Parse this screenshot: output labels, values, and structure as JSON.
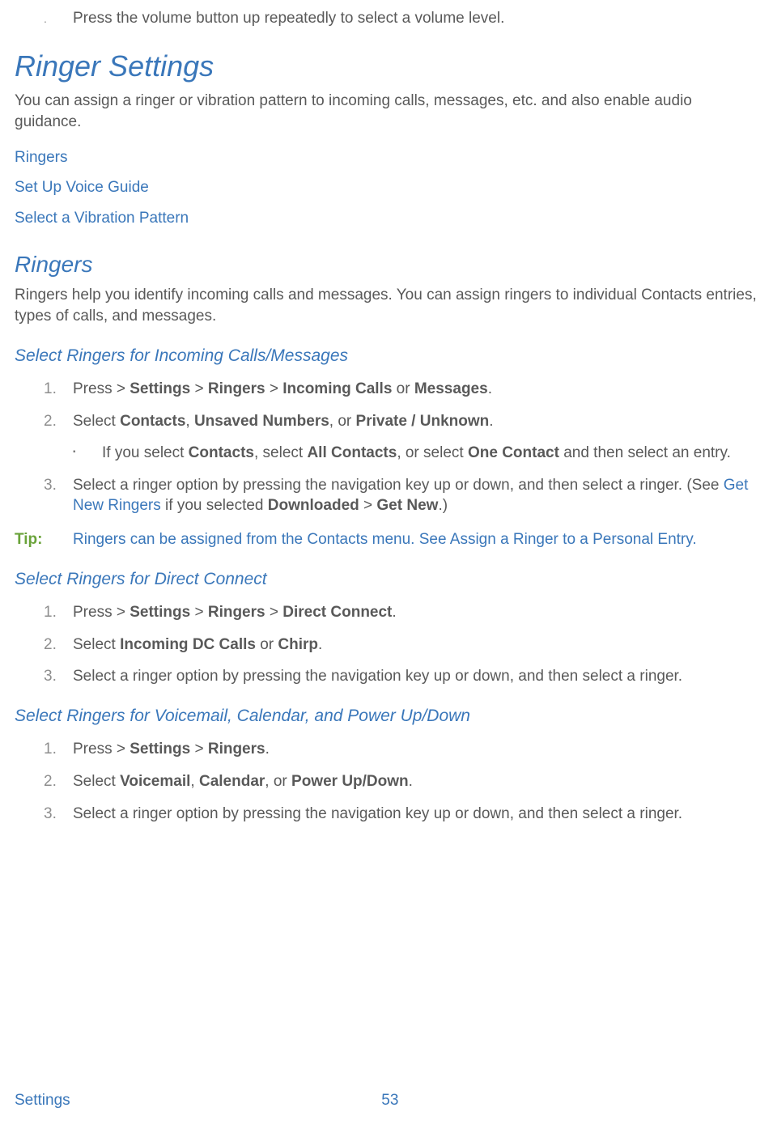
{
  "top_bullet": "Press the volume button up repeatedly to select a volume level.",
  "h1": "Ringer Settings",
  "h1_para": "You can assign a ringer or vibration pattern to incoming calls, messages, etc. and also enable audio guidance.",
  "links": {
    "ringers": "Ringers",
    "voice_guide": "Set Up Voice Guide",
    "vibration": "Select a Vibration Pattern"
  },
  "h2": "Ringers",
  "h2_para": "Ringers help you identify incoming calls and messages. You can assign ringers to individual Contacts entries, types of calls, and messages.",
  "sec1": {
    "title": "Select Ringers for Incoming Calls/Messages",
    "steps": {
      "s1": {
        "num": "1.",
        "pre": "Press  > ",
        "b1": "Settings",
        "g1": " > ",
        "b2": "Ringers",
        "g2": " > ",
        "b3": "Incoming Calls",
        "g3": " or ",
        "b4": "Messages",
        "g4": "."
      },
      "s2": {
        "num": "2.",
        "pre": "Select ",
        "b1": "Contacts",
        "g1": ", ",
        "b2": "Unsaved Numbers",
        "g2": ", or ",
        "b3": "Private / Unknown",
        "g3": "."
      },
      "sub": {
        "pre": "If you select ",
        "b1": "Contacts",
        "g1": ", select ",
        "b2": "All Contacts",
        "g2": ", or select ",
        "b3": "One Contact",
        "g3": " and then select an entry."
      },
      "s3": {
        "num": "3.",
        "pre": "Select a ringer option by pressing the navigation key up or down, and then select a ringer. (See ",
        "link": "Get New Ringers",
        "mid": " if you selected ",
        "b1": "Downloaded",
        "g1": " > ",
        "b2": "Get New",
        "g2": ".)"
      }
    }
  },
  "tip": {
    "label": "Tip:",
    "pre": "Ringers can be assigned from the Contacts menu. See ",
    "link": "Assign a Ringer to a Personal Entry",
    "post": "."
  },
  "sec2": {
    "title": "Select Ringers for Direct Connect",
    "steps": {
      "s1": {
        "num": "1.",
        "pre": "Press  > ",
        "b1": "Settings",
        "g1": " > ",
        "b2": "Ringers",
        "g2": " > ",
        "b3": "Direct Connect",
        "g3": "."
      },
      "s2": {
        "num": "2.",
        "pre": "Select ",
        "b1": "Incoming DC Calls",
        "g1": " or ",
        "b2": "Chirp",
        "g2": "."
      },
      "s3": {
        "num": "3.",
        "text": "Select a ringer option by pressing the navigation key up or down, and then select a ringer."
      }
    }
  },
  "sec3": {
    "title": "Select Ringers for Voicemail, Calendar, and Power Up/Down",
    "steps": {
      "s1": {
        "num": "1.",
        "pre": "Press  > ",
        "b1": "Settings",
        "g1": " > ",
        "b2": "Ringers",
        "g2": "."
      },
      "s2": {
        "num": "2.",
        "pre": "Select ",
        "b1": "Voicemail",
        "g1": ", ",
        "b2": "Calendar",
        "g2": ", or ",
        "b3": "Power Up/Down",
        "g3": "."
      },
      "s3": {
        "num": "3.",
        "text": "Select a ringer option by pressing the navigation key up or down, and then select a ringer."
      }
    }
  },
  "footer": {
    "section": "Settings",
    "page": "53"
  }
}
